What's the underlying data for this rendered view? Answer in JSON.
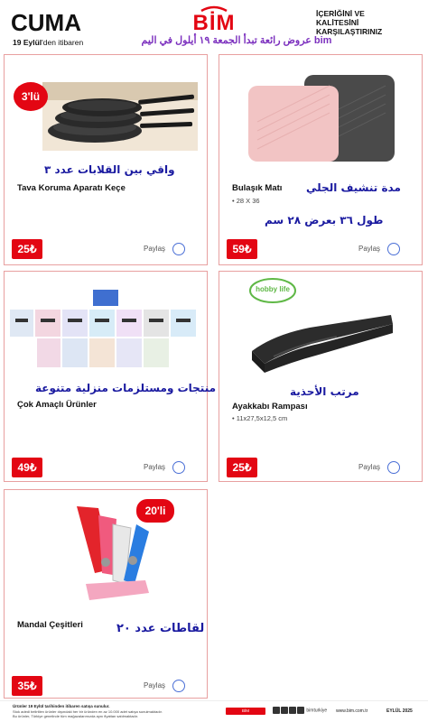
{
  "header": {
    "day": "CUMA",
    "date_bold": "19 Eylül",
    "date_rest": "'den itibaren",
    "logo": "BİM",
    "compare_line1": "İÇERİĞİNİ VE",
    "compare_line2": "KALİTESİNİ",
    "compare_line3": "KARŞILAŞTIRINIZ",
    "arabic_banner": "عروض رائعة تبدأ الجمعة ١٩ أيلول في اليم bim"
  },
  "products": [
    {
      "arabic": "واقي بين القلابات عدد ٣",
      "name": "Tava Koruma Aparatı Keçe",
      "size": "",
      "arabic_note": "",
      "badge": "3'lü",
      "price": "25₺",
      "share": "Paylaş"
    },
    {
      "arabic": "مدة تنشيف الجلي",
      "name": "Bulaşık Matı",
      "size": "• 28 X 36",
      "arabic_note": "طول ٣٦ بعرض ٢٨ سم",
      "badge": "",
      "price": "59₺",
      "share": "Paylaş"
    },
    {
      "arabic": "منتجات ومستلزمات منزلية متنوعة",
      "name": "Çok Amaçlı Ürünler",
      "size": "",
      "arabic_note": "",
      "badge": "",
      "price": "49₺",
      "share": "Paylaş"
    },
    {
      "arabic": "مرتب الأحذية",
      "name": "Ayakkabı Rampası",
      "size": "• 11x27,5x12,5 cm",
      "arabic_note": "",
      "badge": "hobby life",
      "price": "25₺",
      "share": "Paylaş"
    },
    {
      "arabic": "لقاطات عدد ٢٠",
      "name": "Mandal Çeşitleri",
      "size": "",
      "arabic_note": "",
      "badge": "20'li",
      "price": "35₺",
      "share": "Paylaş"
    }
  ],
  "footer": {
    "note1": "Ürünler 19 Eylül tarihinden itibaren satışa sunulur.",
    "note2": "Stok adedi belirtilen ürünler dışındaki her bir üründen en az 10.000 adet satışa sunulmaktadır.",
    "note3": "Bu ürünler, Türkiye genelinde tüm mağazalarımızda aynı fiyattan satılmaktadır.",
    "brand": "BİM",
    "social": "bimturkiye",
    "website": "www.bim.com.tr",
    "month": "EYLÜL 2025"
  },
  "colors": {
    "accent": "#e30613",
    "arabic_text": "#1a1aa0",
    "banner_purple": "#7b2fbe",
    "card_border": "#e8a0a0",
    "share_circle": "#4a6fd6"
  }
}
